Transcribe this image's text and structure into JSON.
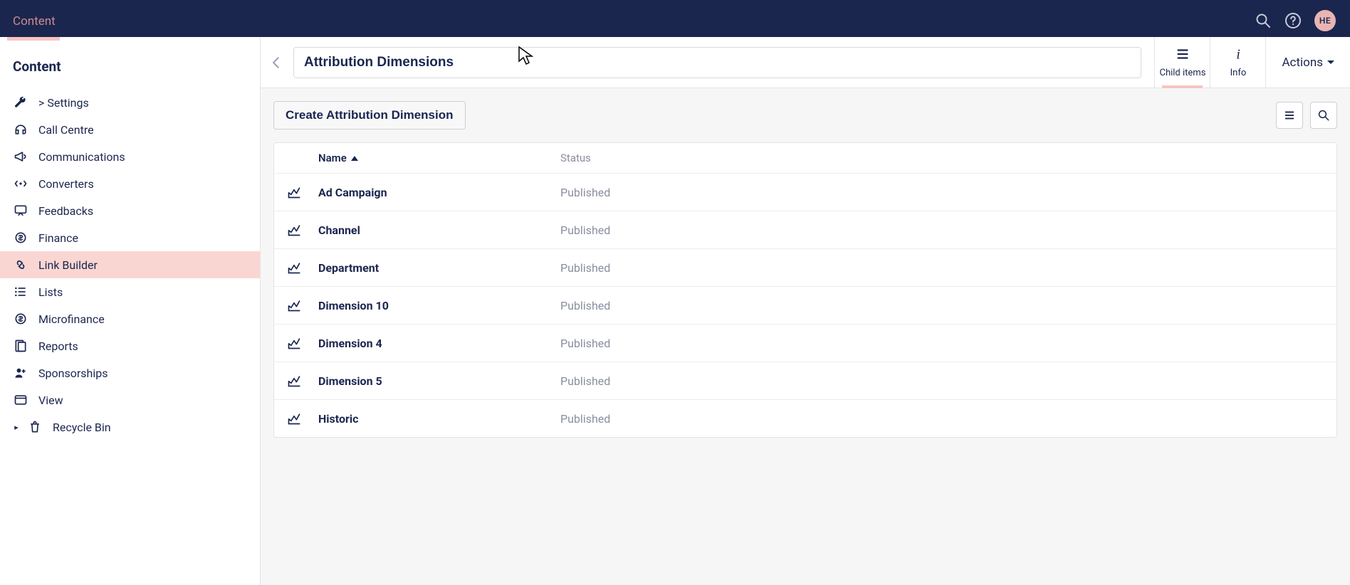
{
  "topbar": {
    "tab_label": "Content",
    "avatar_initials": "HE"
  },
  "sidebar": {
    "title": "Content",
    "items": [
      {
        "label": "> Settings",
        "icon": "wrench"
      },
      {
        "label": "Call Centre",
        "icon": "headset"
      },
      {
        "label": "Communications",
        "icon": "megaphone"
      },
      {
        "label": "Converters",
        "icon": "converter"
      },
      {
        "label": "Feedbacks",
        "icon": "feedback"
      },
      {
        "label": "Finance",
        "icon": "finance"
      },
      {
        "label": "Link Builder",
        "icon": "link"
      },
      {
        "label": "Lists",
        "icon": "list"
      },
      {
        "label": "Microfinance",
        "icon": "finance"
      },
      {
        "label": "Reports",
        "icon": "reports"
      },
      {
        "label": "Sponsorships",
        "icon": "sponsor"
      },
      {
        "label": "View",
        "icon": "view"
      },
      {
        "label": "Recycle Bin",
        "icon": "trash",
        "expandable": true
      }
    ],
    "active_index": 6
  },
  "header": {
    "title_value": "Attribution Dimensions",
    "tabs": {
      "child_items": "Child items",
      "info": "Info"
    },
    "actions_label": "Actions"
  },
  "toolbar": {
    "create_label": "Create Attribution Dimension"
  },
  "table": {
    "columns": {
      "name": "Name",
      "status": "Status"
    },
    "rows": [
      {
        "name": "Ad Campaign",
        "status": "Published"
      },
      {
        "name": "Channel",
        "status": "Published"
      },
      {
        "name": "Department",
        "status": "Published"
      },
      {
        "name": "Dimension 10",
        "status": "Published"
      },
      {
        "name": "Dimension 4",
        "status": "Published"
      },
      {
        "name": "Dimension 5",
        "status": "Published"
      },
      {
        "name": "Historic",
        "status": "Published"
      }
    ]
  }
}
